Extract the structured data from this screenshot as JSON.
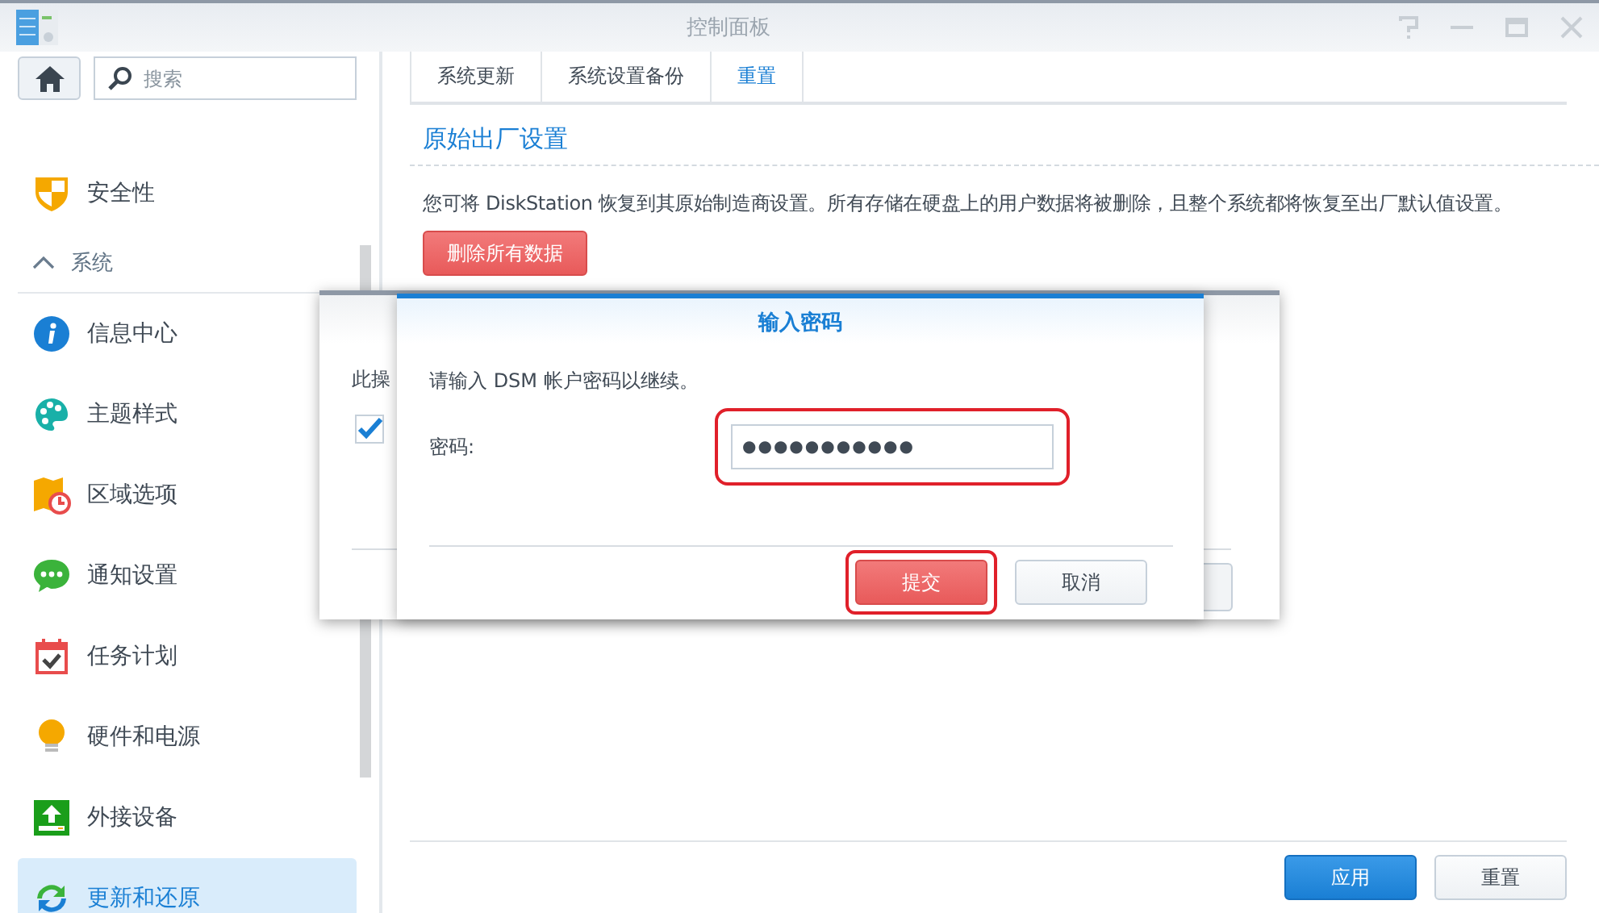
{
  "window": {
    "title": "控制面板"
  },
  "search": {
    "placeholder": "搜索"
  },
  "sidebar": {
    "items": [
      {
        "kind": "item",
        "label": "安全性",
        "selected": false
      },
      {
        "kind": "group",
        "label": "系统",
        "expanded": true,
        "children": [
          {
            "kind": "item",
            "label": "信息中心",
            "selected": false
          },
          {
            "kind": "item",
            "label": "主题样式",
            "selected": false
          },
          {
            "kind": "item",
            "label": "区域选项",
            "selected": false
          },
          {
            "kind": "item",
            "label": "通知设置",
            "selected": false
          },
          {
            "kind": "item",
            "label": "任务计划",
            "selected": false
          },
          {
            "kind": "item",
            "label": "硬件和电源",
            "selected": false
          },
          {
            "kind": "item",
            "label": "外接设备",
            "selected": false
          },
          {
            "kind": "item",
            "label": "更新和还原",
            "selected": true
          }
        ]
      }
    ]
  },
  "tabs": [
    {
      "label": "系统更新",
      "selected": false
    },
    {
      "label": "系统设置备份",
      "selected": false
    },
    {
      "label": "重置",
      "selected": true
    }
  ],
  "section": {
    "title": "原始出厂设置",
    "text": "您可将 DiskStation 恢复到其原始制造商设置。所有存储在硬盘上的用户数据将被删除，且整个系统都将恢复至出厂默认值设置。",
    "button": "删除所有数据"
  },
  "footer_buttons": [
    {
      "label": "应用",
      "kind": "primary"
    },
    {
      "label": "重置",
      "kind": "normal"
    }
  ],
  "back_dialog": {
    "text": "此操",
    "checked": true
  },
  "dialog": {
    "title": "输入密码",
    "message": "请输入 DSM 帐户密码以继续。",
    "field_label": "密码:",
    "password": "●●●●●●●●●●●",
    "field_highlighted": true,
    "buttons": [
      {
        "label": "提交",
        "kind": "danger",
        "highlighted": true
      },
      {
        "label": "取消",
        "kind": "normal",
        "highlighted": false
      }
    ]
  }
}
